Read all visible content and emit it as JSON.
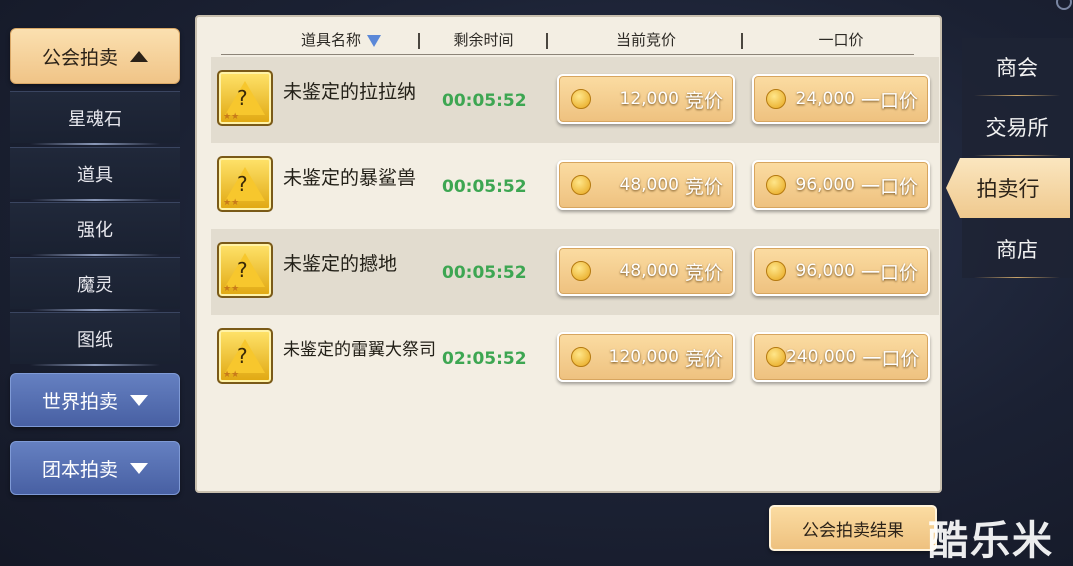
{
  "left_menu": {
    "guild_auction": "公会拍卖",
    "sub_items": [
      "星魂石",
      "道具",
      "强化",
      "魔灵",
      "图纸"
    ],
    "world_auction": "世界拍卖",
    "team_auction": "团本拍卖"
  },
  "table": {
    "headers": {
      "name": "道具名称",
      "time": "剩余时间",
      "bid": "当前竞价",
      "buyout": "一口价"
    },
    "rows": [
      {
        "name": "未鉴定的拉拉纳",
        "time": "00:05:52",
        "bid_price": "12,000",
        "bid_label": "竞价",
        "buyout_price": "24,000",
        "buyout_label": "一口价",
        "icon": "pet-egg-icon",
        "glyph": "?"
      },
      {
        "name": "未鉴定的暴鲨兽",
        "time": "00:05:52",
        "bid_price": "48,000",
        "bid_label": "竞价",
        "buyout_price": "96,000",
        "buyout_label": "一口价",
        "icon": "pet-egg-icon",
        "glyph": "?"
      },
      {
        "name": "未鉴定的撼地",
        "time": "00:05:52",
        "bid_price": "48,000",
        "bid_label": "竞价",
        "buyout_price": "96,000",
        "buyout_label": "一口价",
        "icon": "pet-egg-icon",
        "glyph": "?"
      },
      {
        "name": "未鉴定的雷翼大祭司",
        "time": "02:05:52",
        "bid_price": "120,000",
        "bid_label": "竞价",
        "buyout_price": "240,000",
        "buyout_label": "一口价",
        "icon": "pet-egg-icon",
        "glyph": "?"
      }
    ]
  },
  "right_tabs": [
    "商会",
    "交易所",
    "拍卖行",
    "商店"
  ],
  "active_right_tab": "拍卖行",
  "result_button": "公会拍卖结果",
  "watermark": "酷乐米",
  "colors": {
    "time_green": "#3da652",
    "gold_button": "#f2c98a",
    "blue_button": "#5670b4",
    "panel_bg": "#f3eee3"
  }
}
